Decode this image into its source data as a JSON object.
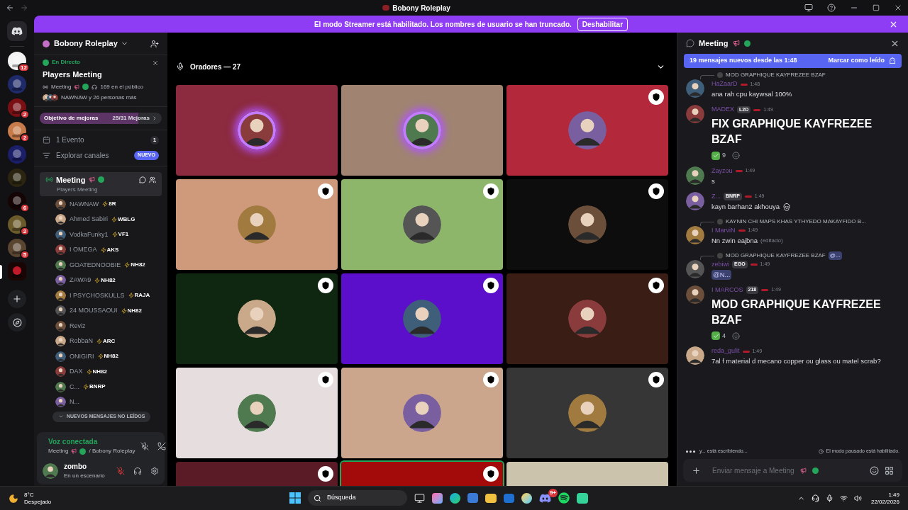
{
  "window": {
    "title": "Bobony Roleplay"
  },
  "banner": {
    "text": "El modo Streamer está habilitado. Los nombres de usuario se han truncado.",
    "button": "Deshabilitar"
  },
  "servers": [
    {
      "badge": "12",
      "selected": false
    },
    {
      "selected": false
    },
    {
      "badge": "2",
      "selected": false
    },
    {
      "badge": "2",
      "selected": false
    },
    {
      "selected": false
    },
    {
      "selected": false
    },
    {
      "badge": "6",
      "selected": false
    },
    {
      "badge": "2",
      "selected": false
    },
    {
      "badge": "5",
      "selected": false
    },
    {
      "selected": true
    }
  ],
  "sidebar": {
    "server_name": "Bobony Roleplay",
    "live": {
      "status": "En Directo",
      "title": "Players Meeting",
      "channel": "Meeting",
      "audience": "169 en el público",
      "participants": "NAWNAW y 26 personas más"
    },
    "boost": {
      "label": "Objetivo de mejoras",
      "progress": "25/31 Mejoras",
      "level": 0.806
    },
    "event": {
      "label": "1 Evento",
      "count": "1"
    },
    "explore": {
      "label": "Explorar canales",
      "badge": "NUEVO"
    },
    "channel": {
      "name": "Meeting",
      "topic": "Players Meeting",
      "selected": true
    },
    "members": [
      {
        "name": "NAWNAW",
        "tag": "8R"
      },
      {
        "name": "Ahmed Sabiri",
        "tag": "WBLG"
      },
      {
        "name": "VodkaFunky1",
        "tag": "VF1"
      },
      {
        "name": "I OMEGA",
        "tag": "AKS"
      },
      {
        "name": "GOATEDNOOBIE",
        "tag": "NH82"
      },
      {
        "name": "ZAWA9",
        "tag": "NH82"
      },
      {
        "name": "I PSYCHOSKULLS",
        "tag": "RAJA"
      },
      {
        "name": "24 MOUSSAOUI",
        "tag": "NH82"
      },
      {
        "name": "Reviz"
      },
      {
        "name": "RobbaN",
        "tag": "ARC"
      },
      {
        "name": "ONIGIRI",
        "tag": "NH82"
      },
      {
        "name": "DAX",
        "tag": "NH82"
      },
      {
        "name": "C...",
        "tag": "BNRP"
      },
      {
        "name": "N..."
      }
    ],
    "unread_pill": "NUEVOS MENSAJES NO LEÍDOS",
    "voice": {
      "status": "Voz conectada",
      "channel": "Meeting",
      "server": "/ Bobony Roleplay"
    },
    "user": {
      "name": "zombo",
      "status": "En un escenario"
    }
  },
  "stage": {
    "heading": "Oradores — 27",
    "tiles": [
      {
        "color": "#8c2a3f",
        "moderator": false,
        "speaking": true
      },
      {
        "color": "#a08471",
        "moderator": false,
        "speaking": true
      },
      {
        "color": "#b3283a",
        "moderator": true,
        "speaking": false
      },
      {
        "color": "#cf9a7c",
        "moderator": true,
        "speaking": false
      },
      {
        "color": "#8db66a",
        "moderator": true,
        "speaking": false
      },
      {
        "color": "#0d0d0d",
        "moderator": true,
        "speaking": false
      },
      {
        "color": "#0f2611",
        "moderator": true,
        "speaking": false
      },
      {
        "color": "#5b0fca",
        "moderator": true,
        "speaking": false
      },
      {
        "color": "#3a1d14",
        "moderator": true,
        "speaking": false
      },
      {
        "color": "#e6dede",
        "moderator": true,
        "speaking": false
      },
      {
        "color": "#cba68c",
        "moderator": true,
        "speaking": false
      },
      {
        "color": "#363636",
        "moderator": true,
        "speaking": false
      },
      {
        "color": "#5b1b26",
        "moderator": true,
        "speaking": false
      },
      {
        "color": "#a30b0b",
        "moderator": true,
        "speaking": true
      },
      {
        "color": "#cbc3ab",
        "moderator": false,
        "speaking": false
      }
    ]
  },
  "chat": {
    "title": "Meeting",
    "new_messages": "19 mensajes nuevos desde las 1:48",
    "mark_read": "Marcar como leído",
    "messages": [
      {
        "reply": "MOD GRAPHIQUE KAYFREZEE BZAF",
        "author": "HaZaarD",
        "time": "1:48",
        "text": "ana rah cpu kaywsal 100%",
        "big": false,
        "mention": false
      },
      {
        "author": "MADEX",
        "tag": "L2D",
        "time": "1:49",
        "text": "FIX GRAPHIQUE KAYFREZEE BZAF",
        "big": true,
        "mention": false,
        "reaction": "9"
      },
      {
        "author": "Zayzou",
        "time": "1:49",
        "text": "s",
        "big": false,
        "mention": false
      },
      {
        "author": "Z...",
        "tag": "BNRP",
        "time": "1:49",
        "text": "kayn barhan2 akhouya",
        "big": false,
        "mention": false,
        "emoji": {
          "kind": "skull"
        }
      },
      {
        "reply": "KAYNIN CHI MAPS KHAS YTHYEDO MAKAYFIDO B...",
        "author": "I MarviN",
        "time": "1:49",
        "text": "Nn zwin eajbna",
        "edited": "(editado)",
        "big": false,
        "mention": false
      },
      {
        "reply": "MOD GRAPHIQUE KAYFREZEE BZAF",
        "reply_mention": "@...",
        "author": "zebiwi",
        "tag": "EGO",
        "time": "1:49",
        "text": "@N...",
        "big": false,
        "mention": true
      },
      {
        "author": "I MARCOS",
        "tag": "218",
        "time": "1:49",
        "text": "MOD GRAPHIQUE KAYFREZEE BZAF",
        "big": true,
        "mention": false,
        "reaction": "4"
      },
      {
        "author": "reda_gulit",
        "time": "1:49",
        "text": "7al f material d mecano copper ou glass ou matel scrab?",
        "big": false,
        "mention": false
      }
    ],
    "typing": "y... está escribiendo...",
    "slowmode": "El modo pausado está habilitado.",
    "placeholder": "Enviar mensaje a Meeting"
  },
  "taskbar": {
    "temperature": "8°C",
    "weather": "Despejado",
    "search": "Búsqueda",
    "discord_badge": "9+",
    "time": "1:49",
    "date": "22/02/2026"
  }
}
